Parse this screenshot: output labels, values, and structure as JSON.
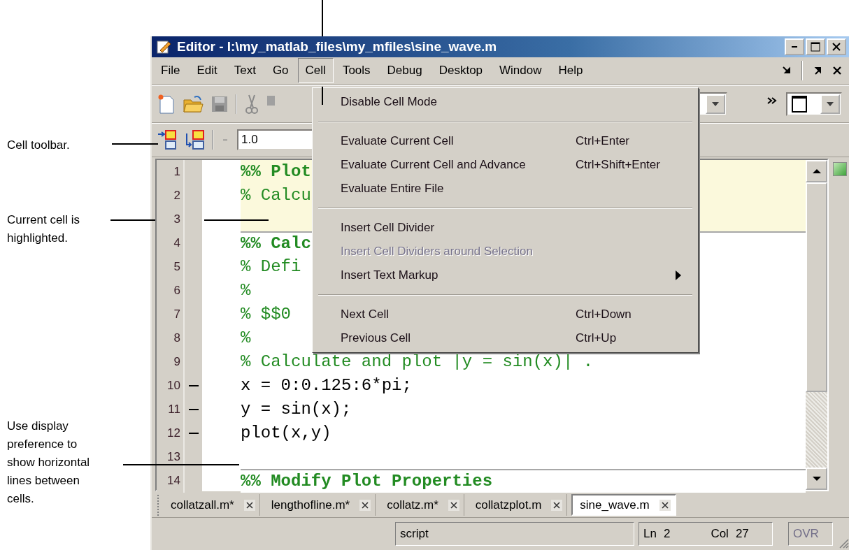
{
  "callouts": [
    {
      "text": "Cell toolbar."
    },
    {
      "text": "Current cell is highlighted."
    },
    {
      "text": "Use display preference to show horizontal lines between cells."
    }
  ],
  "window": {
    "title": "Editor - I:\\my_matlab_files\\my_mfiles\\sine_wave.m"
  },
  "menu_bar": [
    {
      "label": "File",
      "selected": false
    },
    {
      "label": "Edit",
      "selected": false
    },
    {
      "label": "Text",
      "selected": false
    },
    {
      "label": "Go",
      "selected": false
    },
    {
      "label": "Cell",
      "selected": true
    },
    {
      "label": "Tools",
      "selected": false
    },
    {
      "label": "Debug",
      "selected": false
    },
    {
      "label": "Desktop",
      "selected": false
    },
    {
      "label": "Window",
      "selected": false
    },
    {
      "label": "Help",
      "selected": false
    }
  ],
  "cell_toolbar": {
    "magnitude_field": {
      "value": "1.0"
    }
  },
  "cell_menu": [
    {
      "kind": "item",
      "label": "Disable Cell Mode",
      "disabled": false
    },
    {
      "kind": "separator"
    },
    {
      "kind": "item",
      "label": "Evaluate Current Cell",
      "shortcut": "Ctrl+Enter",
      "disabled": false
    },
    {
      "kind": "item",
      "label": "Evaluate Current Cell and Advance",
      "shortcut": "Ctrl+Shift+Enter",
      "disabled": false
    },
    {
      "kind": "item",
      "label": "Evaluate Entire File",
      "disabled": false
    },
    {
      "kind": "separator"
    },
    {
      "kind": "item",
      "label": "Insert Cell Divider",
      "disabled": false
    },
    {
      "kind": "item",
      "label": "Insert Cell Dividers around Selection",
      "disabled": true
    },
    {
      "kind": "submenu",
      "label": "Insert Text Markup",
      "disabled": false
    },
    {
      "kind": "separator"
    },
    {
      "kind": "item",
      "label": "Next Cell",
      "shortcut": "Ctrl+Down",
      "disabled": false
    },
    {
      "kind": "item",
      "label": "Previous Cell",
      "shortcut": "Ctrl+Up",
      "disabled": false
    }
  ],
  "editor": {
    "lines": [
      {
        "number": "1",
        "kind": "cell_title",
        "text": "%% Plot",
        "executable": false,
        "highlighted": true
      },
      {
        "number": "2",
        "kind": "comment",
        "text": "% Calcu",
        "executable": false,
        "highlighted": true
      },
      {
        "number": "3",
        "kind": "code",
        "executable": false,
        "highlighted": true
      },
      {
        "number": "4",
        "kind": "cell_title",
        "text": "%% Calc",
        "executable": false,
        "highlighted": false
      },
      {
        "number": "5",
        "kind": "comment",
        "text": "% Defi",
        "executable": false,
        "highlighted": false
      },
      {
        "number": "6",
        "kind": "comment",
        "text": "%",
        "executable": false,
        "highlighted": false
      },
      {
        "number": "7",
        "kind": "comment",
        "text": "% $$0",
        "executable": false,
        "highlighted": false
      },
      {
        "number": "8",
        "kind": "comment",
        "text": "%",
        "executable": false,
        "highlighted": false
      },
      {
        "number": "9",
        "kind": "comment",
        "text": "% Calculate and plot |y = sin(x)| .",
        "executable": false,
        "highlighted": false
      },
      {
        "number": "10",
        "kind": "code",
        "text": "x = 0:0.125:6*pi;",
        "executable": true,
        "highlighted": false
      },
      {
        "number": "11",
        "kind": "code",
        "text": "y = sin(x);",
        "executable": true,
        "highlighted": false
      },
      {
        "number": "12",
        "kind": "code",
        "text": "plot(x,y)",
        "executable": true,
        "highlighted": false
      },
      {
        "number": "13",
        "kind": "code",
        "executable": false,
        "highlighted": false
      },
      {
        "number": "14",
        "kind": "cell_title",
        "text": "%% Modify Plot Properties",
        "executable": false,
        "highlighted": false
      }
    ]
  },
  "tabs": [
    {
      "label": "collatzall.m*",
      "selected": false
    },
    {
      "label": "lengthofline.m*",
      "selected": false
    },
    {
      "label": "collatz.m*",
      "selected": false
    },
    {
      "label": "collatzplot.m",
      "selected": false
    },
    {
      "label": "sine_wave.m",
      "selected": true
    }
  ],
  "status_bar": {
    "mode": "script",
    "line_label": "Ln",
    "line": "2",
    "column_label": "Col",
    "column": "27",
    "overwrite": {
      "label": "OVR",
      "disabled": true
    }
  }
}
